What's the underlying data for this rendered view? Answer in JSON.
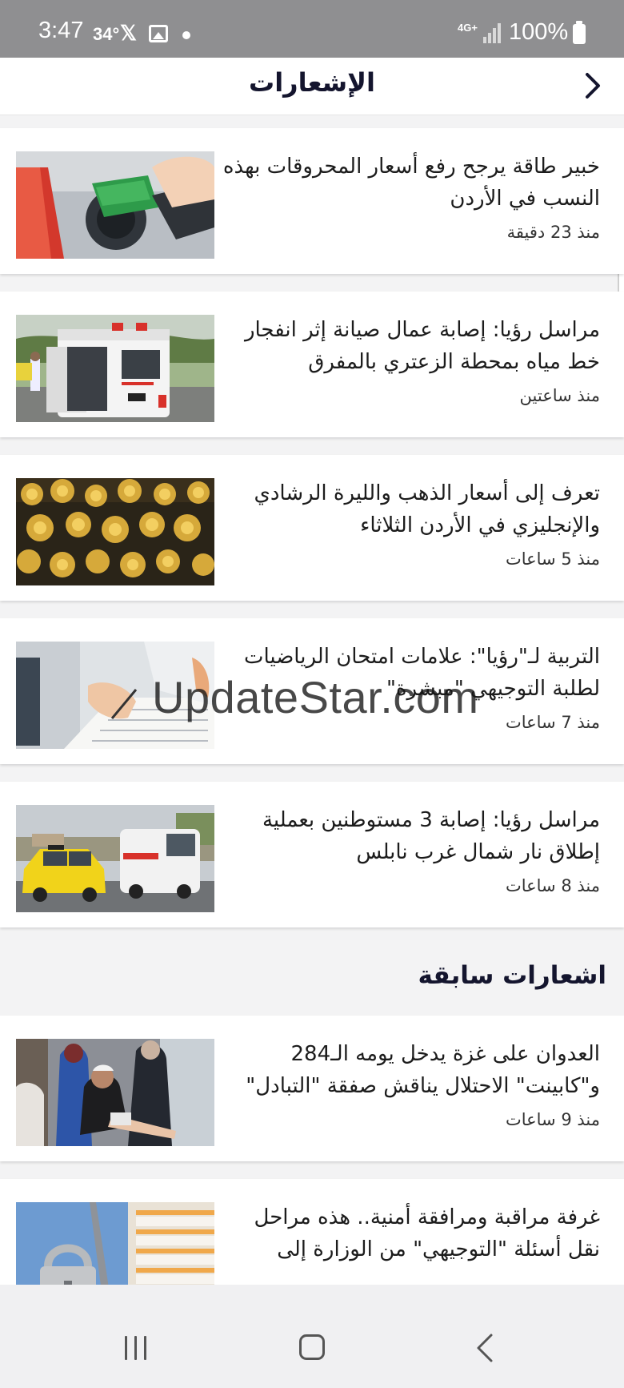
{
  "status_bar": {
    "time": "3:47",
    "temperature": "34°",
    "network": "4G+",
    "battery": "100%"
  },
  "header": {
    "title": "الإشعارات",
    "back_icon": "chevron-right-icon"
  },
  "notifications": [
    {
      "title": "خبير طاقة يرجح رفع أسعار المحروقات بهذه النسب في الأردن",
      "time": "منذ 23 دقيقة",
      "thumbnail": "fuel-pump-image"
    },
    {
      "title": "مراسل رؤيا: إصابة عمال صيانة إثر انفجار خط مياه بمحطة الزعتري بالمفرق",
      "time": "منذ ساعتين",
      "thumbnail": "ambulance-image"
    },
    {
      "title": "تعرف إلى أسعار الذهب والليرة الرشادي والإنجليزي في الأردن الثلاثاء",
      "time": "منذ 5 ساعات",
      "thumbnail": "gold-jewelry-image"
    },
    {
      "title": "التربية لـ\"رؤيا\": علامات امتحان الرياضيات لطلبة التوجيهي \"مبشرة\"",
      "time": "منذ 7 ساعات",
      "thumbnail": "exam-paper-image"
    },
    {
      "title": "مراسل رؤيا: إصابة 3 مستوطنين بعملية إطلاق نار شمال غرب نابلس",
      "time": "منذ 8 ساعات",
      "thumbnail": "taxi-ambulance-image"
    }
  ],
  "previous_section": {
    "title": "اشعارات سابقة",
    "items": [
      {
        "title": "العدوان على غزة يدخل يومه الـ284 و\"كابينت\" الاحتلال يناقش صفقة \"التبادل\"",
        "time": "منذ 9 ساعات",
        "thumbnail": "injured-child-image"
      },
      {
        "title": "غرفة مراقبة ومرافقة أمنية.. هذه مراحل نقل أسئلة \"التوجيهي\" من الوزارة إلى",
        "time": "",
        "thumbnail": "padlock-papers-image"
      }
    ]
  },
  "watermark": "UpdateStar.com",
  "colors": {
    "status_bar": "#8f8f91",
    "title_text": "#14152e",
    "page_background": "#f3f3f4",
    "card_background": "#ffffff"
  }
}
